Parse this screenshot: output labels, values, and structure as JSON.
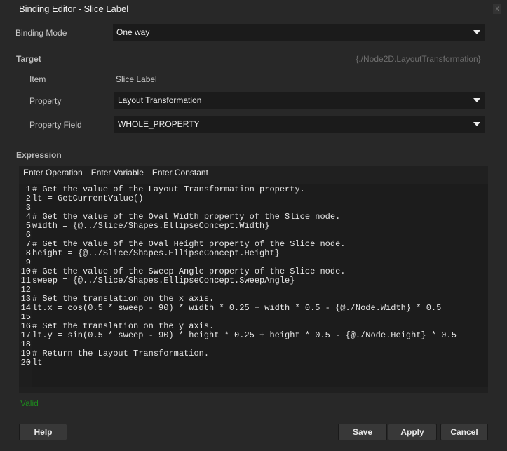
{
  "window": {
    "title": "Binding Editor - Slice Label",
    "close": "x"
  },
  "binding_mode": {
    "label": "Binding Mode",
    "value": "One way"
  },
  "target": {
    "label": "Target",
    "path": "{./Node2D.LayoutTransformation} =",
    "item_label": "Item",
    "item_value": "Slice Label",
    "property_label": "Property",
    "property_value": "Layout Transformation",
    "field_label": "Property Field",
    "field_value": "WHOLE_PROPERTY"
  },
  "expression": {
    "label": "Expression",
    "toolbar": [
      "Enter Operation",
      "Enter Variable",
      "Enter Constant"
    ],
    "lines": [
      "# Get the value of the Layout Transformation property.",
      "lt = GetCurrentValue()",
      "",
      "# Get the value of the Oval Width property of the Slice node.",
      "width = {@../Slice/Shapes.EllipseConcept.Width}",
      "",
      "# Get the value of the Oval Height property of the Slice node.",
      "height = {@../Slice/Shapes.EllipseConcept.Height}",
      "",
      "# Get the value of the Sweep Angle property of the Slice node.",
      "sweep = {@../Slice/Shapes.EllipseConcept.SweepAngle}",
      "",
      "# Set the translation on the x axis.",
      "lt.x = cos(0.5 * sweep - 90) * width * 0.25 + width * 0.5 - {@./Node.Width} * 0.5",
      "",
      "# Set the translation on the y axis.",
      "lt.y = sin(0.5 * sweep - 90) * height * 0.25 + height * 0.5 - {@./Node.Height} * 0.5",
      "",
      "# Return the Layout Transformation.",
      "lt"
    ],
    "status": "Valid"
  },
  "buttons": {
    "help": "Help",
    "save": "Save",
    "apply": "Apply",
    "cancel": "Cancel"
  }
}
